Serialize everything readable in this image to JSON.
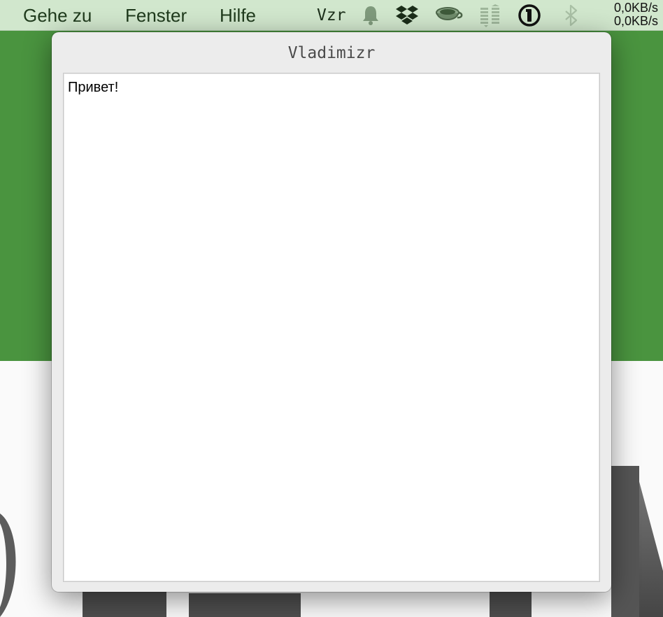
{
  "menubar": {
    "menus": [
      "Gehe zu",
      "Fenster",
      "Hilfe"
    ],
    "status_text": "Vzr",
    "status_icons": [
      "bell-icon",
      "dropbox-icon",
      "teacup-icon",
      "stack-icon",
      "1password-icon",
      "bluetooth-icon"
    ],
    "net_speed": {
      "upload": "0,0KB/s",
      "download": "0,0KB/s"
    }
  },
  "window": {
    "title": "Vladimizr",
    "text_content": "Привет!"
  },
  "colors": {
    "menubar_bg": "#d1e7cd",
    "desktop_green": "#4a943f",
    "window_bg": "#ececec"
  }
}
